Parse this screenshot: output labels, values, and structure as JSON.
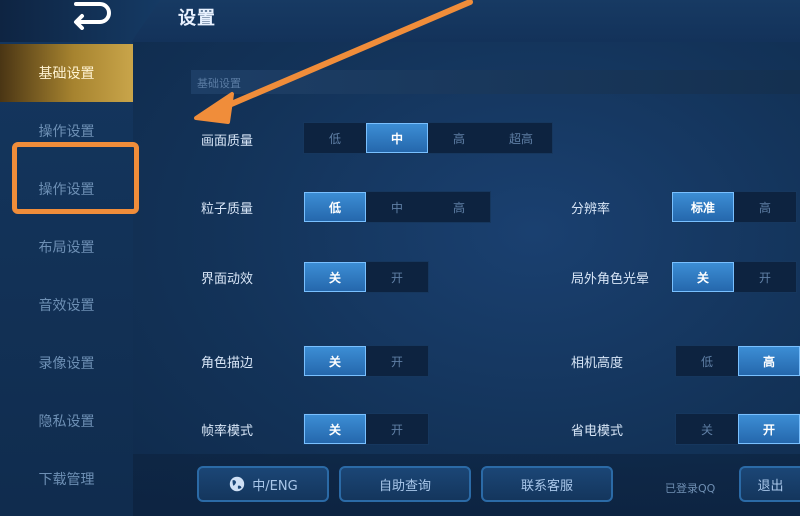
{
  "header": {
    "title": "设置"
  },
  "sidebar": {
    "items": [
      {
        "label": "基础设置",
        "active": true
      },
      {
        "label": "操作设置"
      },
      {
        "label": "操作设置"
      },
      {
        "label": "布局设置"
      },
      {
        "label": "音效设置"
      },
      {
        "label": "录像设置"
      },
      {
        "label": "隐私设置"
      },
      {
        "label": "下载管理"
      }
    ]
  },
  "main": {
    "section_title": "基础设置",
    "settings": {
      "picture_quality": {
        "label": "画面质量",
        "options": [
          "低",
          "中",
          "高",
          "超高"
        ],
        "selected": "中"
      },
      "particle_quality": {
        "label": "粒子质量",
        "options": [
          "低",
          "中",
          "高"
        ],
        "selected": "低"
      },
      "resolution": {
        "label": "分辨率",
        "options": [
          "标准",
          "高"
        ],
        "selected": "标准"
      },
      "ui_animation": {
        "label": "界面动效",
        "options": [
          "关",
          "开"
        ],
        "selected": "关"
      },
      "outline": {
        "label": "局外角色光晕",
        "options": [
          "关",
          "开"
        ],
        "selected": "关"
      },
      "hero_stroke": {
        "label": "角色描边",
        "options": [
          "关",
          "开"
        ],
        "selected": "关"
      },
      "camera_height": {
        "label": "相机高度",
        "options": [
          "低",
          "高"
        ],
        "selected": "高"
      },
      "row5_left": {
        "label": "帧率模式",
        "options": [
          "关",
          "开"
        ],
        "selected": "关"
      },
      "row5_right": {
        "label": "省电模式",
        "options": [
          "关",
          "开"
        ],
        "selected": "开"
      }
    }
  },
  "bottom": {
    "lang_button": "中/ENG",
    "btn2": "自助查询",
    "btn3": "联系客服",
    "qq_text": "已登录QQ",
    "btn4": "退出"
  },
  "colors": {
    "accent": "#2d7cc9",
    "annotation": "#f08d3a",
    "active_tab": "#b08d3a"
  }
}
